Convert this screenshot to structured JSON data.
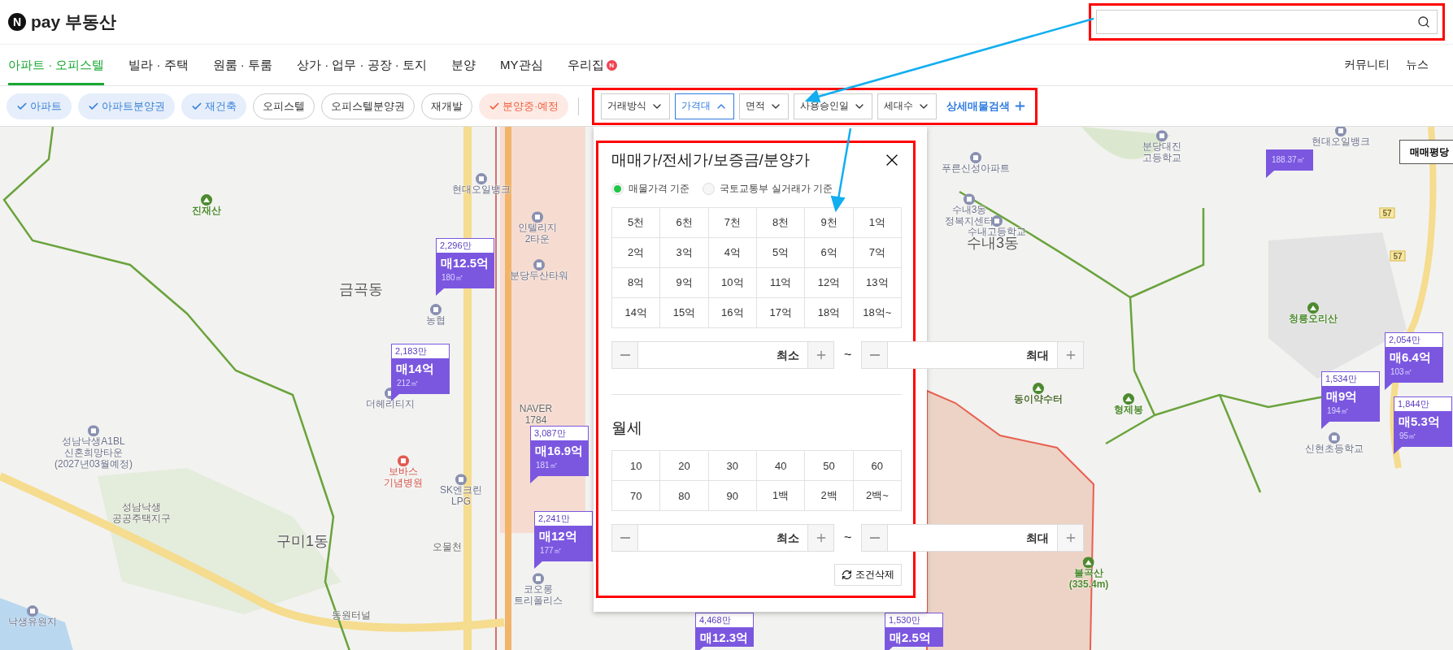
{
  "header": {
    "logo_mark": "N",
    "logo_text": "pay 부동산"
  },
  "nav": {
    "tabs": [
      {
        "label": "아파트 · 오피스텔",
        "selected": true
      },
      {
        "label": "빌라 · 주택",
        "selected": false
      },
      {
        "label": "원룸 · 투룸",
        "selected": false
      },
      {
        "label": "상가 · 업무 · 공장 · 토지",
        "selected": false
      },
      {
        "label": "분양",
        "selected": false
      },
      {
        "label": "MY관심",
        "selected": false
      },
      {
        "label": "우리집",
        "selected": false,
        "badge": "N"
      }
    ],
    "links": [
      "커뮤니티",
      "뉴스"
    ]
  },
  "filters": {
    "chips": [
      {
        "label": "아파트",
        "checked": true,
        "color": "#3b82d9"
      },
      {
        "label": "아파트분양권",
        "checked": true,
        "color": "#3b82d9"
      },
      {
        "label": "재건축",
        "checked": true,
        "color": "#3b82d9"
      },
      {
        "label": "오피스텔",
        "checked": false
      },
      {
        "label": "오피스텔분양권",
        "checked": false
      },
      {
        "label": "재개발",
        "checked": false
      },
      {
        "label": "분양중·예정",
        "checked": true,
        "color": "#f0603c"
      }
    ],
    "dropdowns": [
      {
        "label": "거래방식",
        "expanded": false
      },
      {
        "label": "가격대",
        "expanded": true
      },
      {
        "label": "면적",
        "expanded": false
      },
      {
        "label": "사용승인일",
        "expanded": false
      },
      {
        "label": "세대수",
        "expanded": false
      }
    ],
    "detail_search": "상세매물검색"
  },
  "price_panel": {
    "title": "매매가/전세가/보증금/분양가",
    "basis": [
      {
        "label": "매물가격 기준",
        "selected": true
      },
      {
        "label": "국토교통부 실거래가 기준",
        "selected": false
      }
    ],
    "prices": [
      "5천",
      "6천",
      "7천",
      "8천",
      "9천",
      "1억",
      "2억",
      "3억",
      "4억",
      "5억",
      "6억",
      "7억",
      "8억",
      "9억",
      "10억",
      "11억",
      "12억",
      "13억",
      "14억",
      "15억",
      "16억",
      "17억",
      "18억",
      "18억~"
    ],
    "price_range": {
      "min_placeholder": "최소",
      "separator": "~",
      "max_placeholder": "최대"
    },
    "rent_title": "월세",
    "rents": [
      "10",
      "20",
      "30",
      "40",
      "50",
      "60",
      "70",
      "80",
      "90",
      "1백",
      "2백",
      "2백~"
    ],
    "rent_range": {
      "min_placeholder": "최소",
      "separator": "~",
      "max_placeholder": "최대"
    },
    "reset": "조건삭제"
  },
  "map": {
    "view_button": "매매평당",
    "labels": [
      {
        "text": "진재산",
        "kind": "mountain"
      },
      {
        "text": "현대오일뱅크",
        "kind": "poi"
      },
      {
        "text": "인텔리지\n2타운",
        "kind": "poi"
      },
      {
        "text": "분당두산타워",
        "kind": "poi"
      },
      {
        "text": "금곡동",
        "kind": "district"
      },
      {
        "text": "농협",
        "kind": "poi"
      },
      {
        "text": "더헤리티지",
        "kind": "poi"
      },
      {
        "text": "NAVER\n1784",
        "kind": "place"
      },
      {
        "text": "성남낙생A1BL\n신혼희망타운\n(2027년03월예정)",
        "kind": "poi"
      },
      {
        "text": "보바스\n기념병원",
        "kind": "hospital"
      },
      {
        "text": "SK엔크린\nLPG",
        "kind": "poi"
      },
      {
        "text": "성남낙생\n공공주택지구",
        "kind": "place"
      },
      {
        "text": "구미1동",
        "kind": "district"
      },
      {
        "text": "오물천",
        "kind": "place"
      },
      {
        "text": "코오롱\n트리폴리스",
        "kind": "poi"
      },
      {
        "text": "낙생유원지",
        "kind": "poi"
      },
      {
        "text": "동원터널",
        "kind": "place"
      },
      {
        "text": "분당대진\n고등학교",
        "kind": "poi"
      },
      {
        "text": "현대오일뱅크",
        "kind": "poi"
      },
      {
        "text": "푸른신성아파트",
        "kind": "poi"
      },
      {
        "text": "수내3동\n정복지센터",
        "kind": "poi"
      },
      {
        "text": "수내고등학교",
        "kind": "poi"
      },
      {
        "text": "수내3동",
        "kind": "district"
      },
      {
        "text": "청룡오리산",
        "kind": "mountain"
      },
      {
        "text": "동이약수터",
        "kind": "trail"
      },
      {
        "text": "형제봉",
        "kind": "mountain"
      },
      {
        "text": "불곡산\n(335.4m)",
        "kind": "mountain"
      },
      {
        "text": "신현초등학교",
        "kind": "poi"
      },
      {
        "text": "57",
        "kind": "road"
      },
      {
        "text": "57",
        "kind": "road"
      }
    ],
    "markers": [
      {
        "unit_price": "2,296만",
        "price": "매12.5억",
        "area": "180㎡"
      },
      {
        "unit_price": "2,183만",
        "price": "매14억",
        "area": "212㎡"
      },
      {
        "unit_price": "3,087만",
        "price": "매16.9억",
        "area": "181㎡"
      },
      {
        "unit_price": "2,241만",
        "price": "매12억",
        "area": "177㎡"
      },
      {
        "unit_price": "2,054만",
        "price": "매6.4억",
        "area": "103㎡"
      },
      {
        "unit_price": "1,534만",
        "price": "매9억",
        "area": "194㎡"
      },
      {
        "unit_price": "1,844만",
        "price": "매5.3억",
        "area": "95㎡"
      },
      {
        "area": "188.37㎡"
      },
      {
        "unit_price": "4,468만",
        "price": "매12.3억"
      },
      {
        "unit_price": "1,530만",
        "price": "매2.5억"
      }
    ]
  }
}
